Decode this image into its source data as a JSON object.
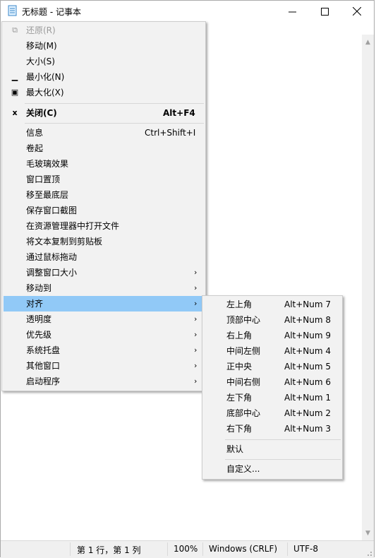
{
  "window": {
    "title": "无标题 - 记事本",
    "minimize_glyph": "—",
    "maximize_glyph": "☐",
    "close_glyph": "✕"
  },
  "statusbar": {
    "position": "第 1 行，第 1 列",
    "zoom": "100%",
    "line_ending": "Windows (CRLF)",
    "encoding": "UTF-8"
  },
  "system_menu": {
    "restore": {
      "label": "还原(R)",
      "icon": "restore-icon"
    },
    "move": {
      "label": "移动(M)"
    },
    "size": {
      "label": "大小(S)"
    },
    "minimize": {
      "label": "最小化(N)",
      "icon": "minimize-icon"
    },
    "maximize": {
      "label": "最大化(X)",
      "icon": "maximize-icon"
    },
    "close": {
      "label": "关闭(C)",
      "shortcut": "Alt+F4",
      "icon": "close-icon"
    },
    "info": {
      "label": "信息",
      "shortcut": "Ctrl+Shift+I"
    },
    "rollup": {
      "label": "卷起"
    },
    "glass": {
      "label": "毛玻璃效果"
    },
    "topmost": {
      "label": "窗口置顶"
    },
    "bottom": {
      "label": "移至最底层"
    },
    "screenshot": {
      "label": "保存窗口截图"
    },
    "open_explorer": {
      "label": "在资源管理器中打开文件"
    },
    "copy_text": {
      "label": "将文本复制到剪贴板"
    },
    "drag": {
      "label": "通过鼠标拖动"
    },
    "resize": {
      "label": "调整窗口大小"
    },
    "move_to": {
      "label": "移动到"
    },
    "align": {
      "label": "对齐"
    },
    "transparency": {
      "label": "透明度"
    },
    "priority": {
      "label": "优先级"
    },
    "tray": {
      "label": "系统托盘"
    },
    "other_windows": {
      "label": "其他窗口"
    },
    "launch": {
      "label": "启动程序"
    },
    "submenu_arrow": "›"
  },
  "align_menu": {
    "items": [
      {
        "label": "左上角",
        "shortcut": "Alt+Num 7"
      },
      {
        "label": "顶部中心",
        "shortcut": "Alt+Num 8"
      },
      {
        "label": "右上角",
        "shortcut": "Alt+Num 9"
      },
      {
        "label": "中间左侧",
        "shortcut": "Alt+Num 4"
      },
      {
        "label": "正中央",
        "shortcut": "Alt+Num 5"
      },
      {
        "label": "中间右侧",
        "shortcut": "Alt+Num 6"
      },
      {
        "label": "左下角",
        "shortcut": "Alt+Num 1"
      },
      {
        "label": "底部中心",
        "shortcut": "Alt+Num 2"
      },
      {
        "label": "右下角",
        "shortcut": "Alt+Num 3"
      }
    ],
    "default": {
      "label": "默认"
    },
    "custom": {
      "label": "自定义..."
    }
  },
  "colors": {
    "highlight": "#91c9f7",
    "menu_bg": "#f2f2f2",
    "disabled_text": "#9b9b9b"
  }
}
